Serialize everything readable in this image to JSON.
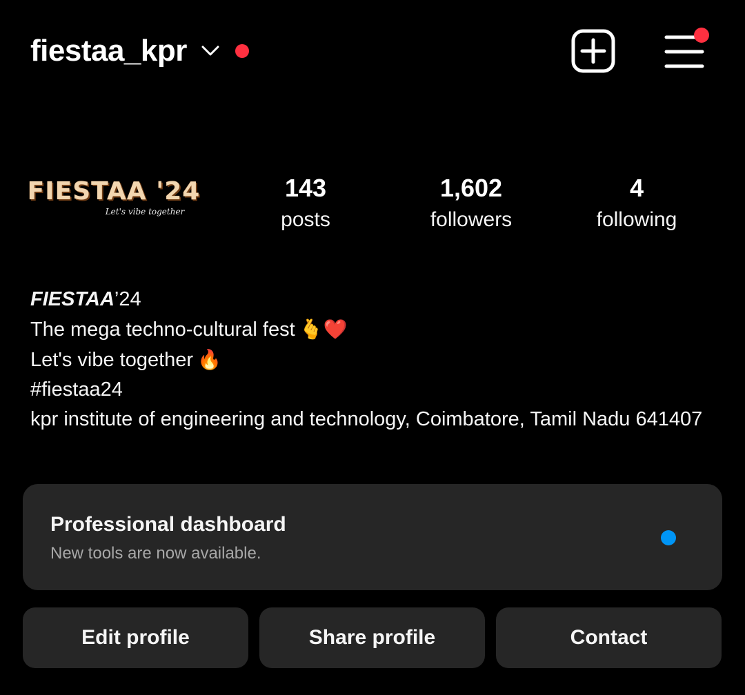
{
  "header": {
    "username": "fiestaa_kpr",
    "account_switch_icon": "chevron-down-icon",
    "new_post_icon": "plus-square-icon",
    "menu_icon": "hamburger-menu-icon"
  },
  "profile": {
    "avatar": {
      "logo_text": "FIESTAA '24",
      "tagline": "Let's vibe together"
    },
    "stats": [
      {
        "value": "143",
        "label": "posts"
      },
      {
        "value": "1,602",
        "label": "followers"
      },
      {
        "value": "4",
        "label": "following"
      }
    ]
  },
  "bio": {
    "name_italic": "FIESTAA",
    "name_rest": "’24",
    "line1_text": "The mega techno-cultural fest",
    "line1_emoji": "🫰❤️",
    "line2_text": "Let's vibe together",
    "line2_emoji": "🔥",
    "hashtag": "#fiestaa24",
    "address": "kpr institute of engineering and technology, Coimbatore, Tamil Nadu 641407"
  },
  "dashboard": {
    "title": "Professional dashboard",
    "subtitle": "New tools are now available."
  },
  "actions": {
    "edit_label": "Edit profile",
    "share_label": "Share profile",
    "contact_label": "Contact"
  },
  "colors": {
    "background": "#000000",
    "card": "#262626",
    "notification_dot": "#ff3040",
    "info_dot": "#0095f6",
    "secondary_text": "#a8a8a8"
  }
}
